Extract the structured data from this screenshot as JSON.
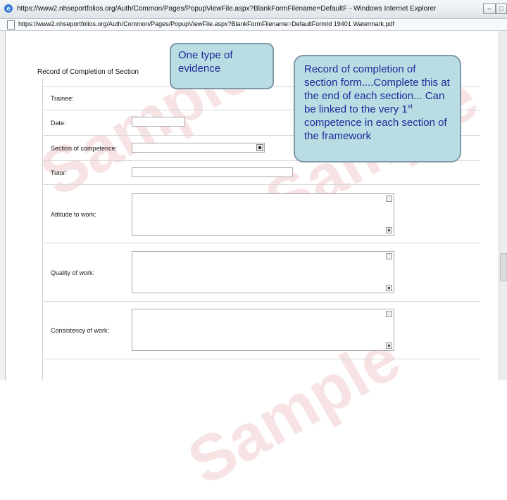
{
  "browser": {
    "title": "https://www2.nhseportfolios.org/Auth/Common/Pages/PopupViewFile.aspx?BlankFormFilename=DefaultF - Windows Internet Explorer",
    "address": "https://www2.nhseportfolios.org/Auth/Common/Pages/PopupViewFile.aspx?BlankFormFilename=DefaultFormId 19401 Watermark.pdf"
  },
  "watermark": "Sample",
  "form": {
    "section_title": "Record of Completion of Section",
    "fields": {
      "trainee": "Trainee:",
      "date": "Date:",
      "section": "Section of competence:",
      "tutor": "Tutor:",
      "attitude": "Attitude to work:",
      "quality": "Quality of work:",
      "consistency": "Consistency of work:"
    }
  },
  "callouts": {
    "type_of_evidence": "One type of evidence",
    "record_main": "Record of completion of section form....Complete this at the end of each section... Can be linked to the very 1",
    "record_sup": "st",
    "record_tail": " competence in each section of the framework"
  },
  "icons": [
    "ie-logo-icon",
    "page-icon",
    "minimize-icon",
    "maximize-icon",
    "dropdown-arrow-icon",
    "scroll-up-icon",
    "scroll-down-icon"
  ]
}
